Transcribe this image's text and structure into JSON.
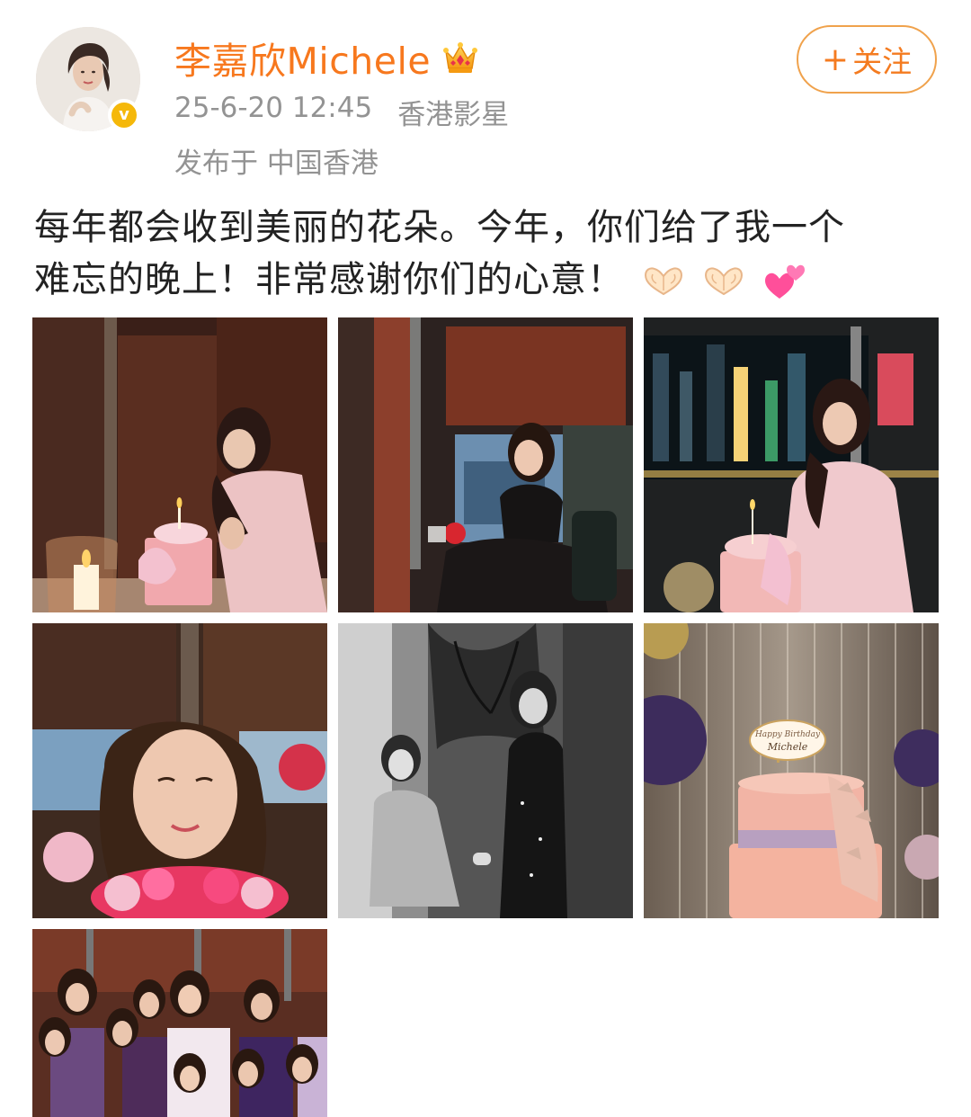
{
  "user": {
    "name": "李嘉欣Michele",
    "avatar_icon": "avatar-image",
    "verified_icon": "verified-badge-icon",
    "verified_mark": "v",
    "vip_icon": "crown-icon"
  },
  "post_meta": {
    "timestamp": "25-6-20 12:45",
    "source": "香港影星",
    "location": "发布于 中国香港"
  },
  "follow": {
    "plus": "+",
    "label": "关注"
  },
  "content": {
    "line1": "每年都会收到美丽的花朵。今年，你们给了我一个",
    "line2": "难忘的晚上！非常感谢你们的心意！",
    "emojis": [
      "heart-hands-emoji",
      "heart-hands-emoji",
      "two-hearts-emoji"
    ]
  },
  "photos": [
    {
      "name": "photo-1",
      "desc_icon": "photo-birthday-candle-blow"
    },
    {
      "name": "photo-2",
      "desc_icon": "photo-black-dress-seated"
    },
    {
      "name": "photo-3",
      "desc_icon": "photo-pink-dress-cake-night-view"
    },
    {
      "name": "photo-4",
      "desc_icon": "photo-smelling-roses"
    },
    {
      "name": "photo-5",
      "desc_icon": "photo-black-white-with-daughter"
    },
    {
      "name": "photo-6",
      "desc_icon": "photo-birthday-cake-tinsel"
    },
    {
      "name": "photo-7",
      "desc_icon": "photo-group-photo"
    }
  ],
  "cake_text": {
    "line1": "Happy Birthday",
    "line2": "Michele"
  },
  "colors": {
    "username": "#f7781e",
    "meta": "#939393",
    "follow_border": "#f0a24c",
    "verified": "#f5b80a"
  }
}
